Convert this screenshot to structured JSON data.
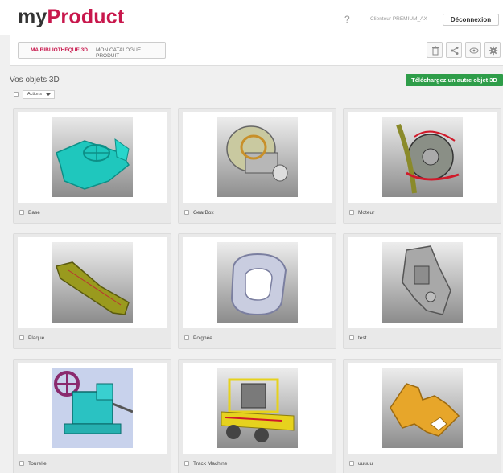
{
  "header": {
    "logo_prefix": "my",
    "logo_suffix": "Product",
    "help": "?",
    "user": "Clienteur PREMIUM_AX",
    "logout": "Déconnexion"
  },
  "tabs": {
    "library": "MA BIBLIOTHÈQUE 3D",
    "catalog": "MON CATALOGUE PRODUIT"
  },
  "toolbar": {
    "icons": [
      "trash-icon",
      "share-icon",
      "eye-icon",
      "gear-icon"
    ]
  },
  "section": {
    "title": "Vos objets 3D",
    "upload": "Téléchargez un autre objet 3D",
    "actions": "Actions"
  },
  "objects": [
    {
      "name": "Base",
      "color": "#1fc7bd"
    },
    {
      "name": "GearBox",
      "color": "#b7b7b7"
    },
    {
      "name": "Moteur",
      "color": "#8a8f86"
    },
    {
      "name": "Plaque",
      "color": "#9a9a1e"
    },
    {
      "name": "Poignée",
      "color": "#c9cde0"
    },
    {
      "name": "test",
      "color": "#a8a8a8"
    },
    {
      "name": "Tourelle",
      "color": "#2ac2c2"
    },
    {
      "name": "Track Machine",
      "color": "#e6d21e"
    },
    {
      "name": "uuuuu",
      "color": "#e7a62a"
    }
  ]
}
